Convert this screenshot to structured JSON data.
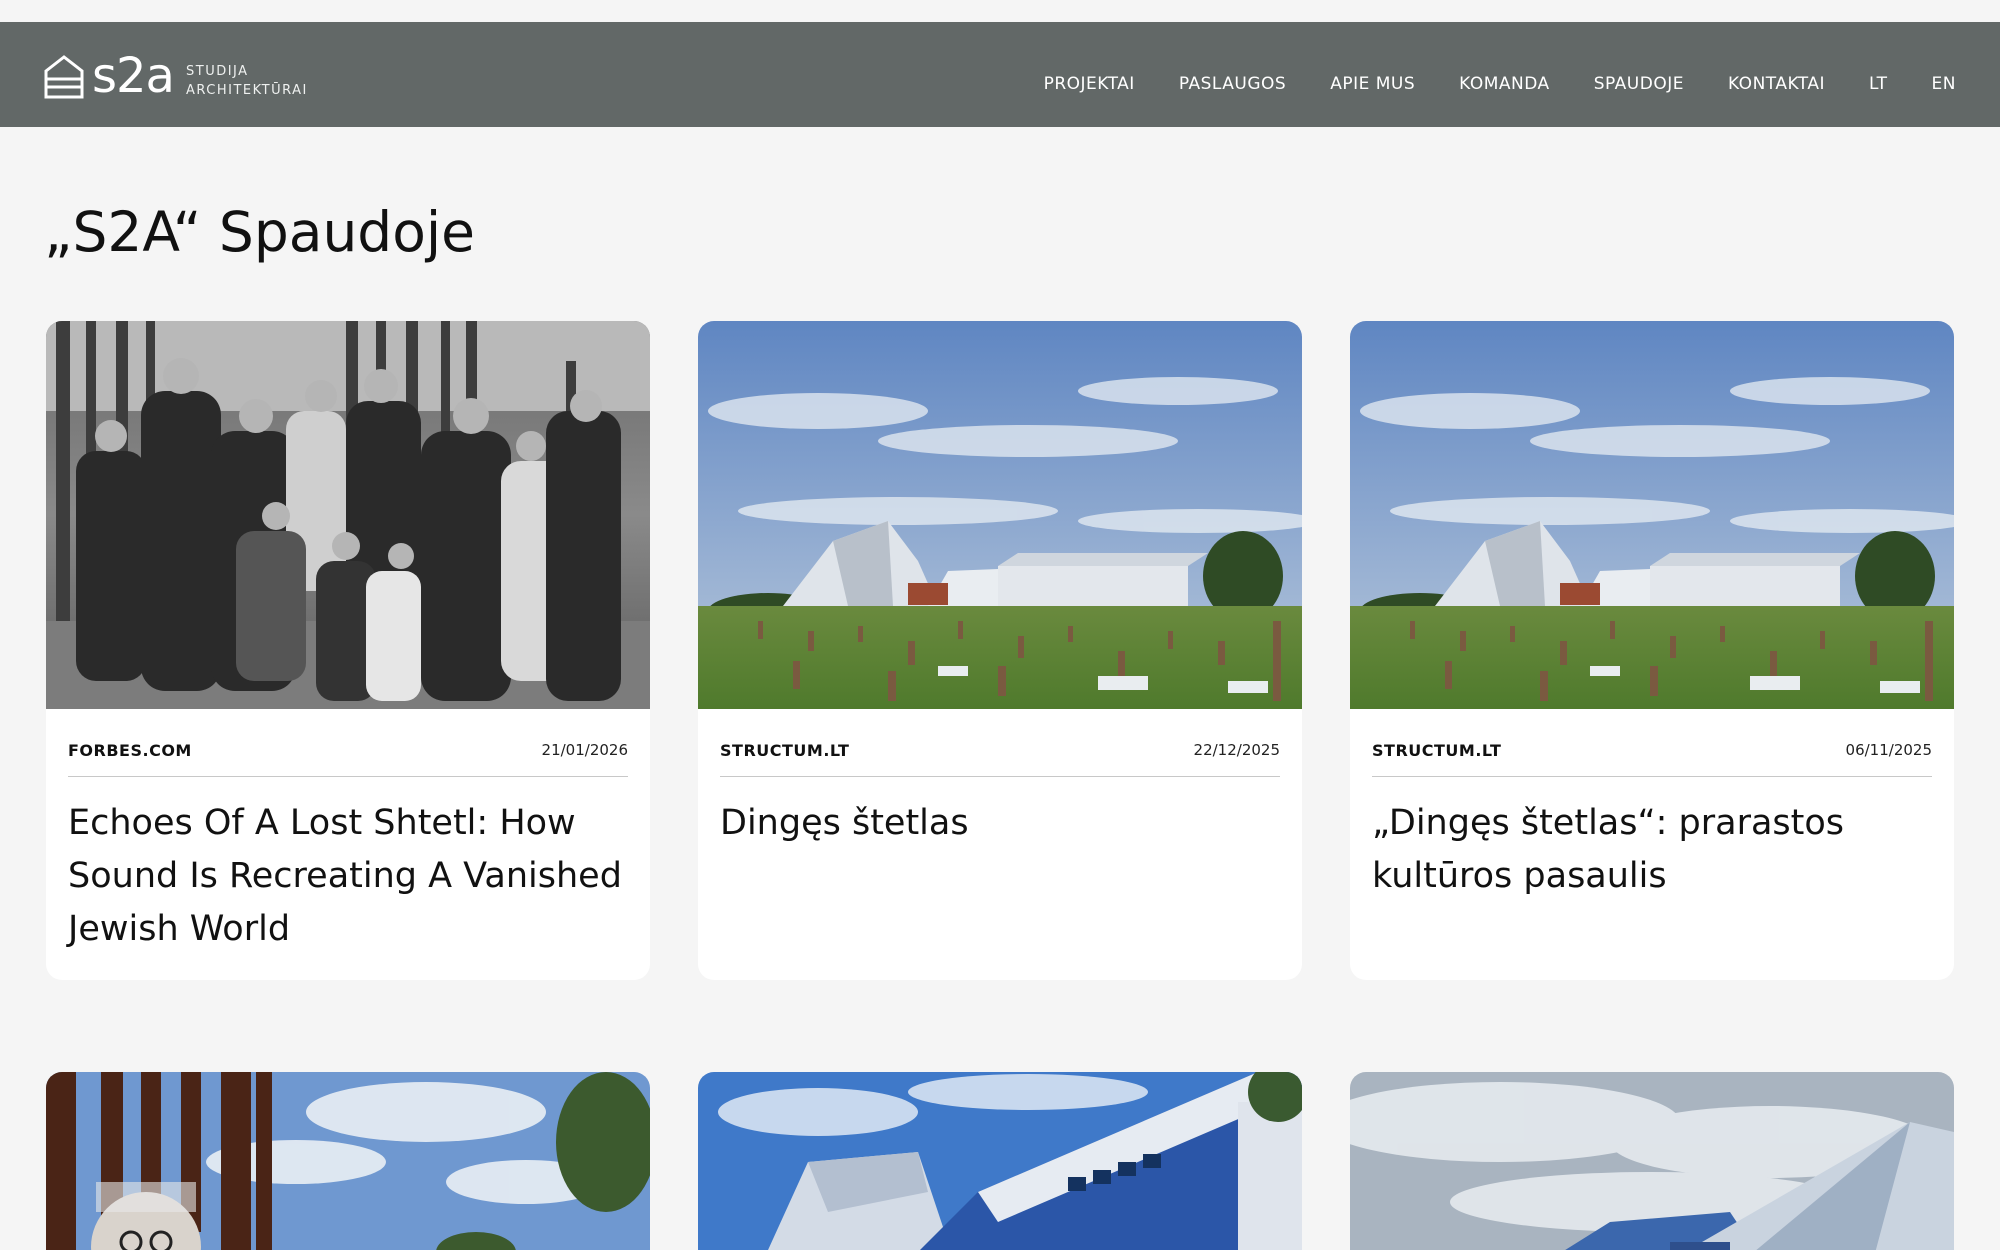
{
  "header": {
    "logo_text": "s2a",
    "logo_sub_line1": "STUDIJA",
    "logo_sub_line2": "ARCHITEKTŪRAI",
    "nav": [
      "PROJEKTAI",
      "PASLAUGOS",
      "APIE MUS",
      "KOMANDA",
      "SPAUDOJE",
      "KONTAKTAI",
      "LT",
      "EN"
    ]
  },
  "page_title": "„S2A“ Spaudoje",
  "articles": [
    {
      "source": "FORBES.COM",
      "date": "21/01/2026",
      "title": "Echoes Of A Lost Shtetl: How Sound Is Recreating A Vanished Jewish World"
    },
    {
      "source": "STRUCTUM.LT",
      "date": "22/12/2025",
      "title": "Dingęs štetlas"
    },
    {
      "source": "STRUCTUM.LT",
      "date": "06/11/2025",
      "title": "„Dingęs štetlas“: prarastos kultūros pasaulis"
    }
  ],
  "colors": {
    "header_bg": "#626867",
    "page_bg": "#f5f5f5",
    "card_bg": "#ffffff"
  }
}
